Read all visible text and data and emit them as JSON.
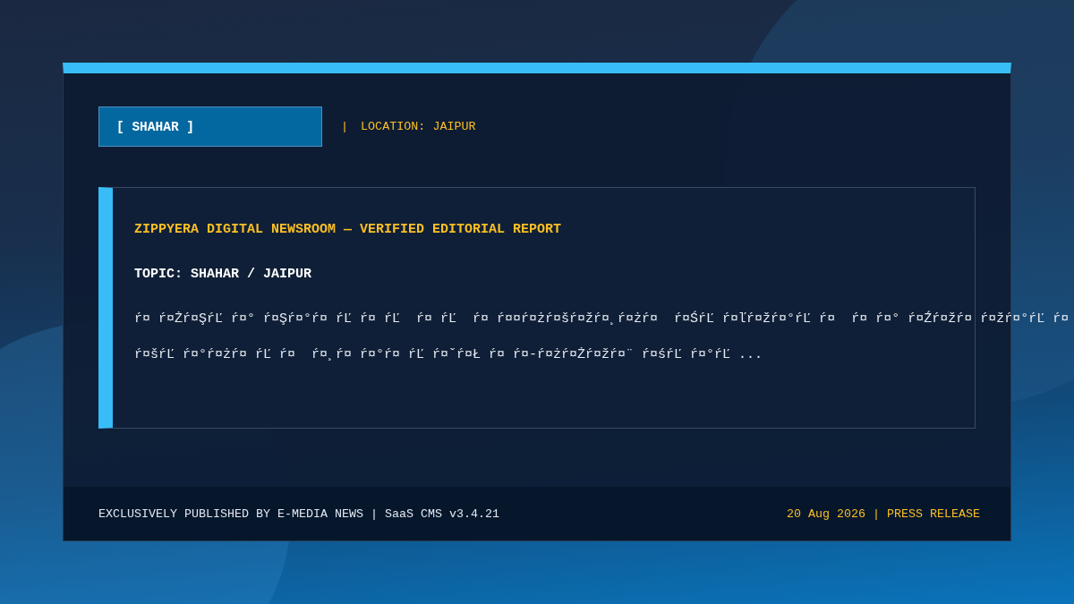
{
  "header": {
    "badge": "[ SHAHAR ]",
    "separator": "|",
    "location": "LOCATION: JAIPUR"
  },
  "article": {
    "title": "ZIPPYERA DIGITAL NEWSROOM — VERIFIED EDITORIAL REPORT",
    "topic": "TOPIC: SHAHAR / JAIPUR",
    "body_lines": [
      "ŕ¤ ŕ¤Żŕ¤ŞŕĽ ŕ¤° ŕ¤Şŕ¤°ŕ¤ ŕĽ ŕ¤ ŕĽ  ŕ¤ ŕĽ  ŕ¤ ŕ¤¤ŕ¤żŕ¤šŕ¤žŕ¤¸ŕ¤żŕ¤  ŕ¤ŚŕĽ ŕ¤ľŕ¤žŕ¤°ŕĽ ŕ¤  ŕ¤ ŕ¤° ŕ¤Źŕ¤žŕ¤ ŕ¤žŕ¤°ŕĽ ŕ¤",
      "ŕ¤šŕĽ ŕ¤°ŕ¤żŕ¤ ŕĽ ŕ¤  ŕ¤¸ŕ¤ ŕ¤°ŕ¤ ŕĽ ŕ¤ˇŕ¤Ł ŕ¤ ŕ¤-ŕ¤żŕ¤Żŕ¤žŕ¤¨ ŕ¤śŕĽ ŕ¤°ŕĽ ..."
    ]
  },
  "footer": {
    "credit": "EXCLUSIVELY PUBLISHED BY E-MEDIA NEWS | SaaS CMS v3.4.21",
    "dateline": "20 Aug 2026 | PRESS RELEASE"
  }
}
